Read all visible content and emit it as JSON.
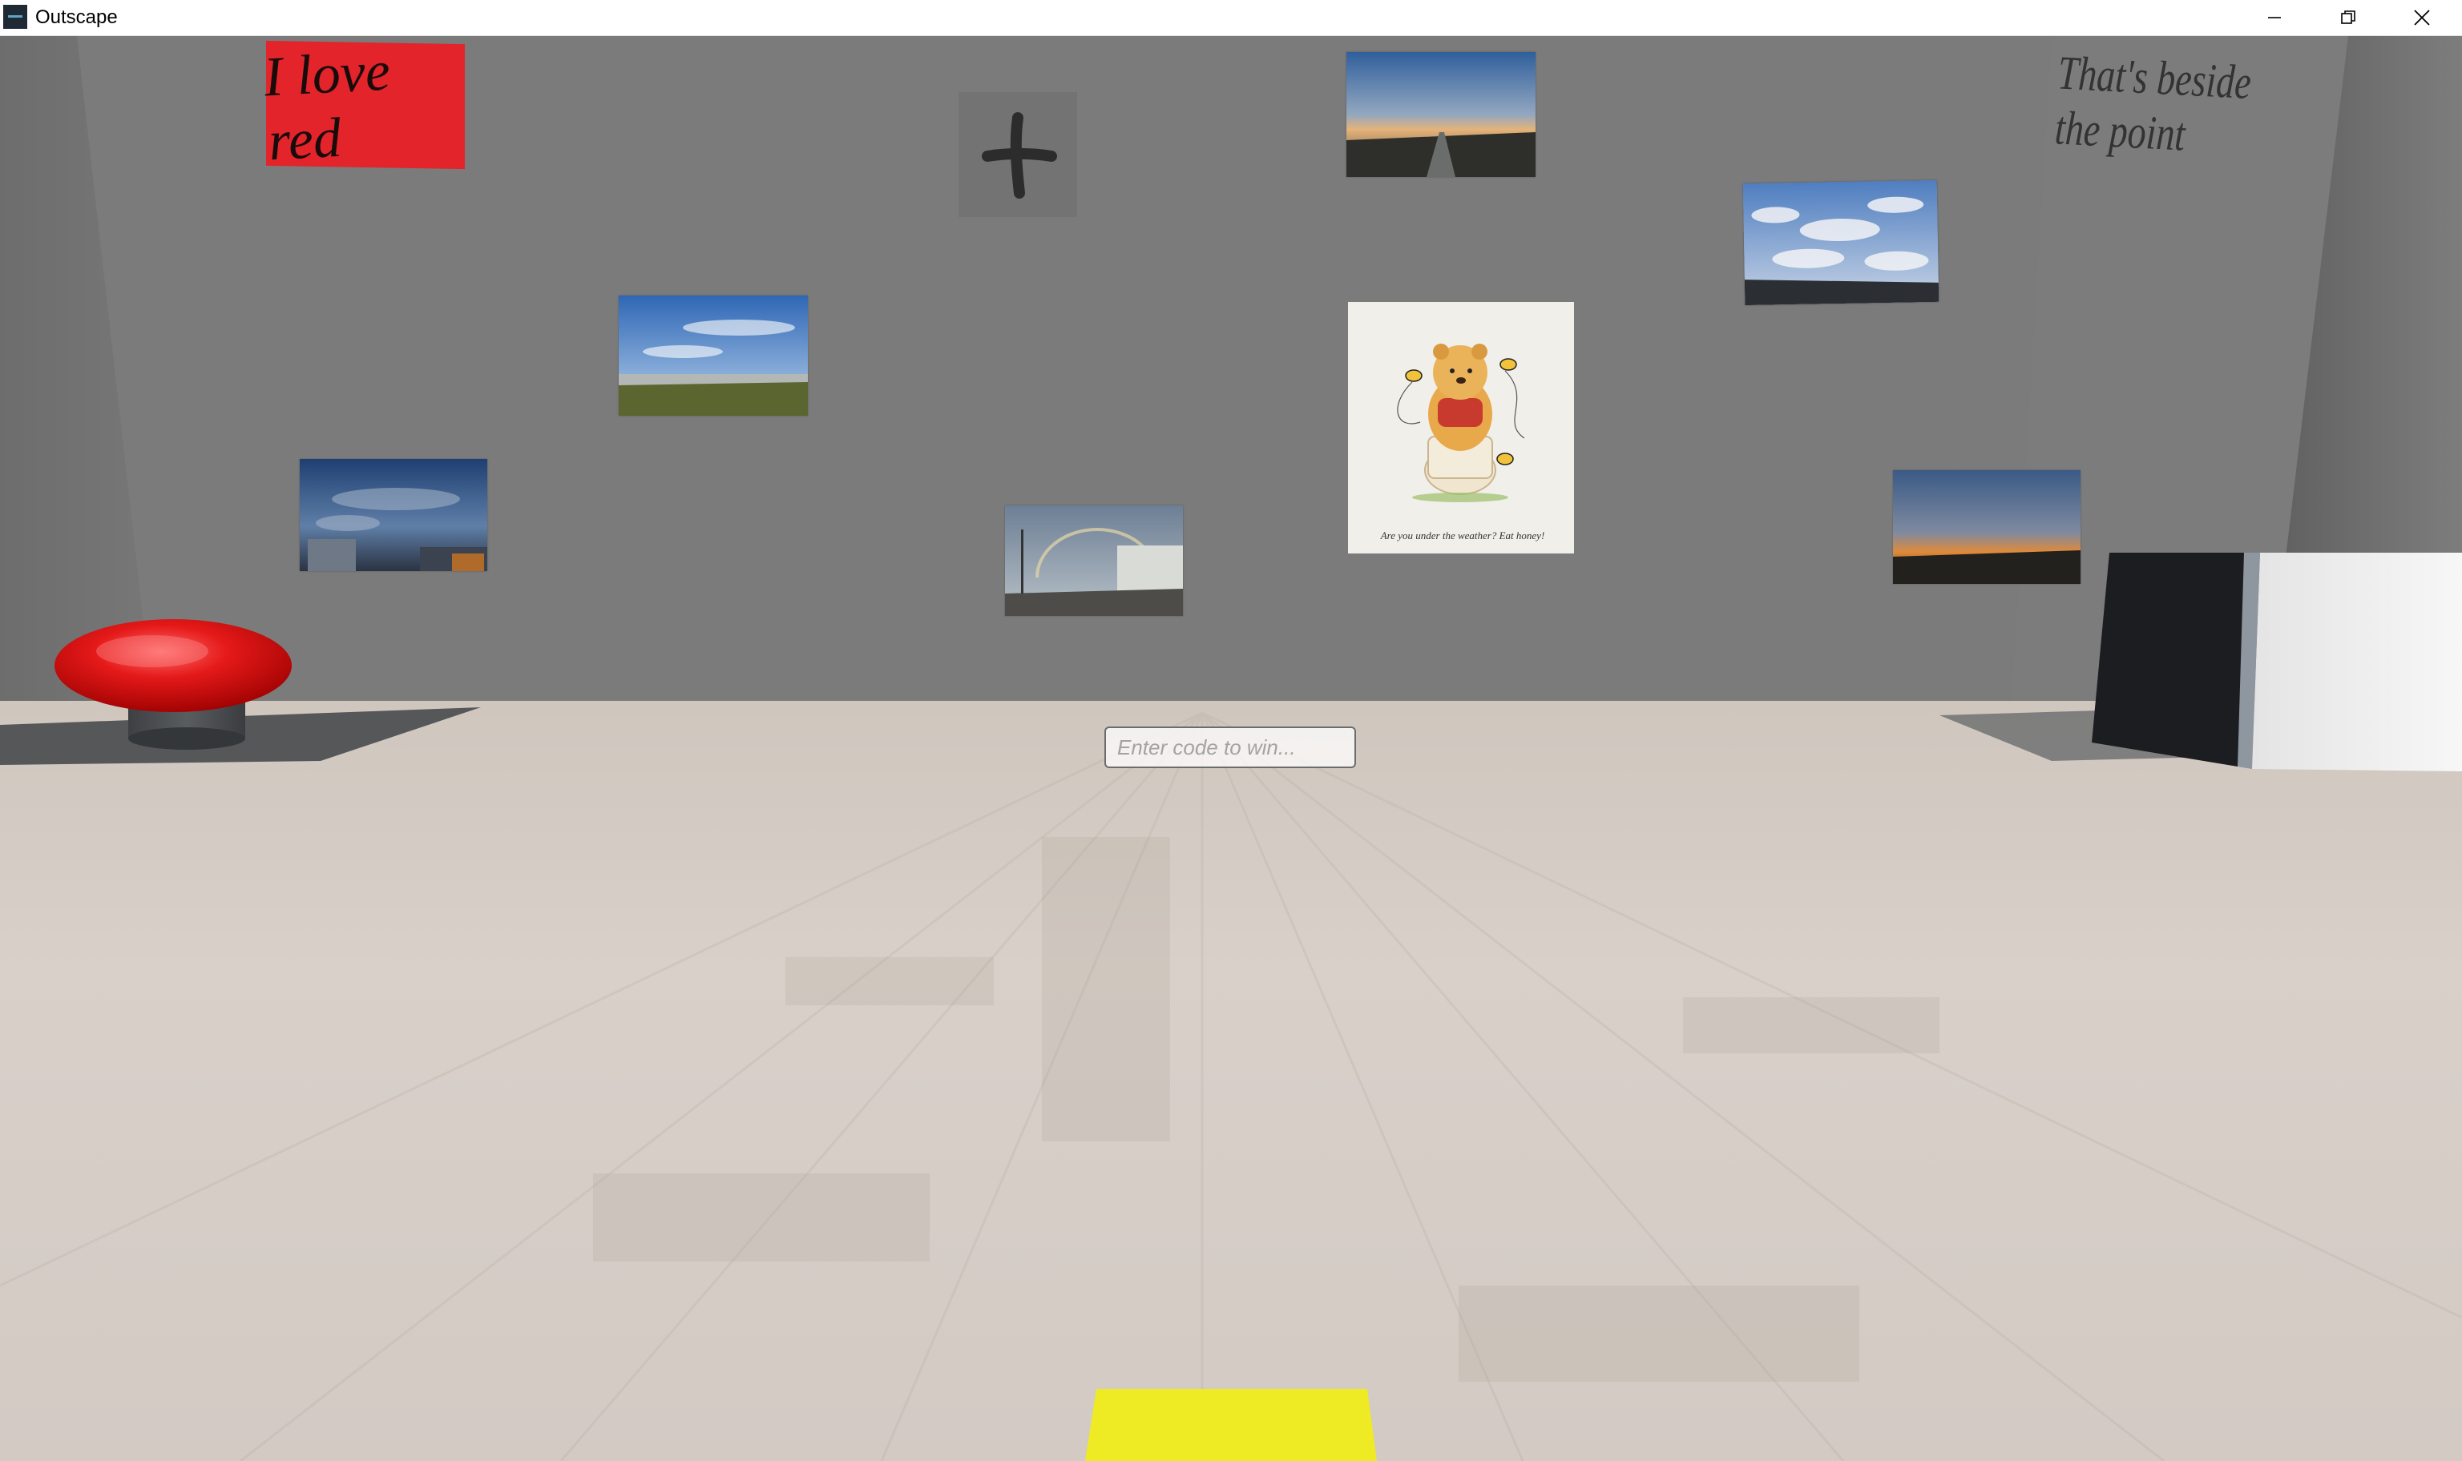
{
  "window": {
    "title": "Outscape",
    "controls": [
      "minimize-icon",
      "restore-icon",
      "close-icon"
    ]
  },
  "scene": {
    "signs": {
      "love_red": "I love red",
      "beside_point": "That's beside the point"
    },
    "poster": {
      "caption": "Are you under the weather? Eat honey!"
    },
    "code_input": {
      "placeholder": "Enter code to win..."
    },
    "colors": {
      "wall": "#7a7a7a",
      "floor": "#d9d2cb",
      "big_button": "#e01a1a",
      "sign_red": "#e3242b",
      "yellow_pad": "#eeea24",
      "crate_dark": "#1b1d20",
      "crate_light": "#f2f2f2"
    },
    "objects": [
      "red-button",
      "plus-tile",
      "crate",
      "yellow-pad"
    ]
  }
}
